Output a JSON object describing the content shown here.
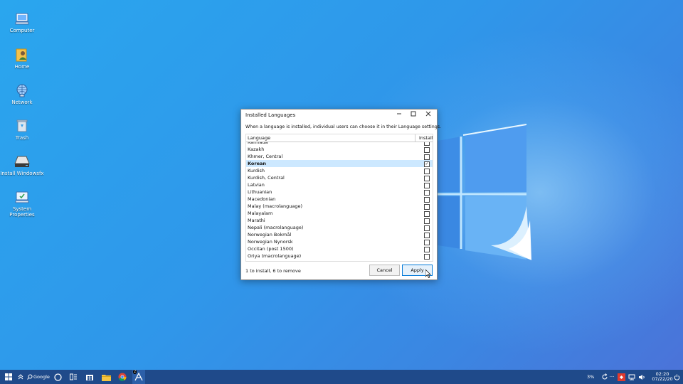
{
  "desktop": {
    "icons": [
      {
        "label": "Computer",
        "icon": "computer-icon"
      },
      {
        "label": "Home",
        "icon": "home-folder-icon"
      },
      {
        "label": "Network",
        "icon": "network-icon"
      },
      {
        "label": "Trash",
        "icon": "trash-icon"
      },
      {
        "label": "Install Windowsfx",
        "icon": "install-drive-icon"
      },
      {
        "label": "System Properties",
        "icon": "system-properties-icon"
      }
    ]
  },
  "dialog": {
    "title": "Installed Languages",
    "description": "When a language is installed, individual users can choose it in their Language settings.",
    "columns": {
      "language": "Language",
      "installed": "Installed"
    },
    "rows": [
      {
        "label": "Kannada",
        "checked": false,
        "selected": false
      },
      {
        "label": "Kazakh",
        "checked": false,
        "selected": false
      },
      {
        "label": "Khmer, Central",
        "checked": false,
        "selected": false
      },
      {
        "label": "Korean",
        "checked": true,
        "selected": true
      },
      {
        "label": "Kurdish",
        "checked": false,
        "selected": false
      },
      {
        "label": "Kurdish, Central",
        "checked": false,
        "selected": false
      },
      {
        "label": "Latvian",
        "checked": false,
        "selected": false
      },
      {
        "label": "Lithuanian",
        "checked": false,
        "selected": false
      },
      {
        "label": "Macedonian",
        "checked": false,
        "selected": false
      },
      {
        "label": "Malay (macrolanguage)",
        "checked": false,
        "selected": false
      },
      {
        "label": "Malayalam",
        "checked": false,
        "selected": false
      },
      {
        "label": "Marathi",
        "checked": false,
        "selected": false
      },
      {
        "label": "Nepali (macrolanguage)",
        "checked": false,
        "selected": false
      },
      {
        "label": "Norwegian Bokmål",
        "checked": false,
        "selected": false
      },
      {
        "label": "Norwegian Nynorsk",
        "checked": false,
        "selected": false
      },
      {
        "label": "Occitan (post 1500)",
        "checked": false,
        "selected": false
      },
      {
        "label": "Oriya (macrolanguage)",
        "checked": false,
        "selected": false
      }
    ],
    "status": "1 to install, 6 to remove",
    "cancel_label": "Cancel",
    "apply_label": "Apply"
  },
  "taskbar": {
    "search_label": "Google",
    "battery": "3%",
    "time": "02:20",
    "date": "07/22/20",
    "badge_count": "2"
  },
  "colors": {
    "desktop": "#2f97ea",
    "taskbar": "#1f4a8a",
    "selection": "#cce8ff",
    "accent": "#0078d7"
  }
}
